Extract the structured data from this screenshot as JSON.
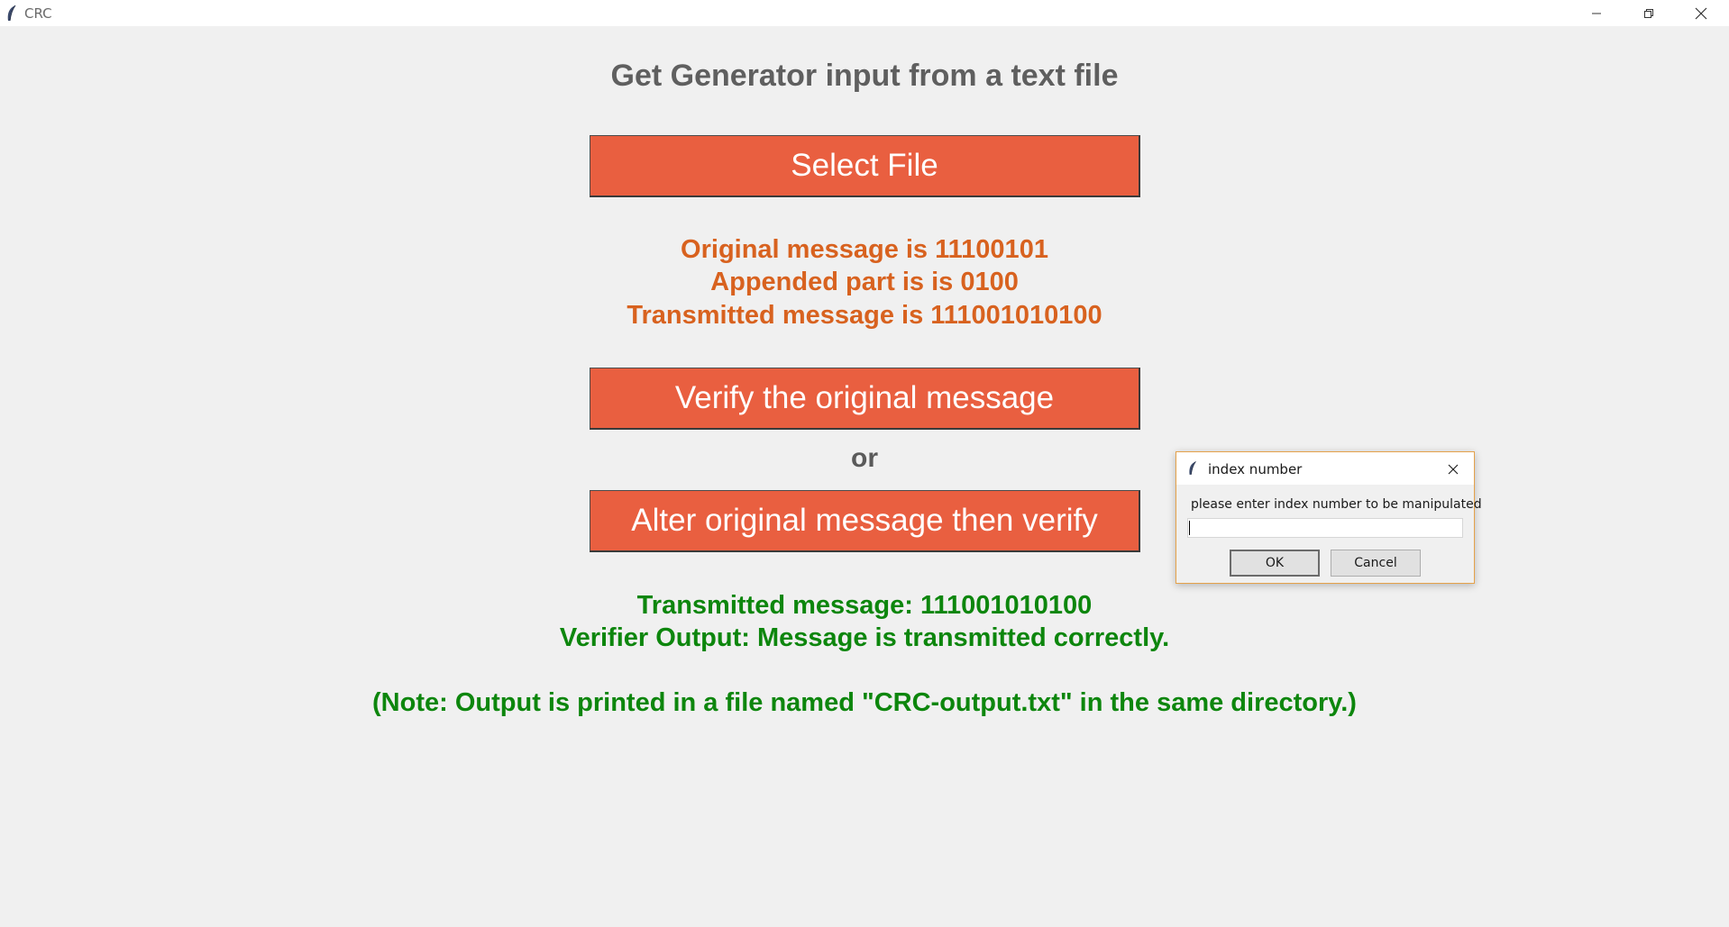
{
  "window": {
    "title": "CRC",
    "icon": "feather-icon",
    "controls": [
      "minimize-icon",
      "restore-icon",
      "close-icon"
    ]
  },
  "main": {
    "heading": "Get Generator input from a text file",
    "select_file_label": "Select File",
    "info": {
      "original": "Original message is 11100101",
      "appended": "Appended part is is 0100",
      "transmitted": "Transmitted message is 111001010100"
    },
    "verify_label": "Verify the original message",
    "or_label": "or",
    "alter_label": "Alter original message then verify",
    "result": {
      "transmitted": "Transmitted message: 111001010100",
      "verifier": "Verifier Output: Message is transmitted correctly."
    },
    "note": "(Note: Output is printed in a file named \"CRC-output.txt\" in the same directory.)"
  },
  "dialog": {
    "title": "index number",
    "prompt": "please enter index number to be manipulated",
    "input_value": "",
    "ok_label": "OK",
    "cancel_label": "Cancel"
  },
  "colors": {
    "button_bg": "#e95f40",
    "info_text": "#d8621f",
    "result_text": "#0d860d",
    "heading_text": "#5f5f5f",
    "background": "#f0f0f0"
  }
}
